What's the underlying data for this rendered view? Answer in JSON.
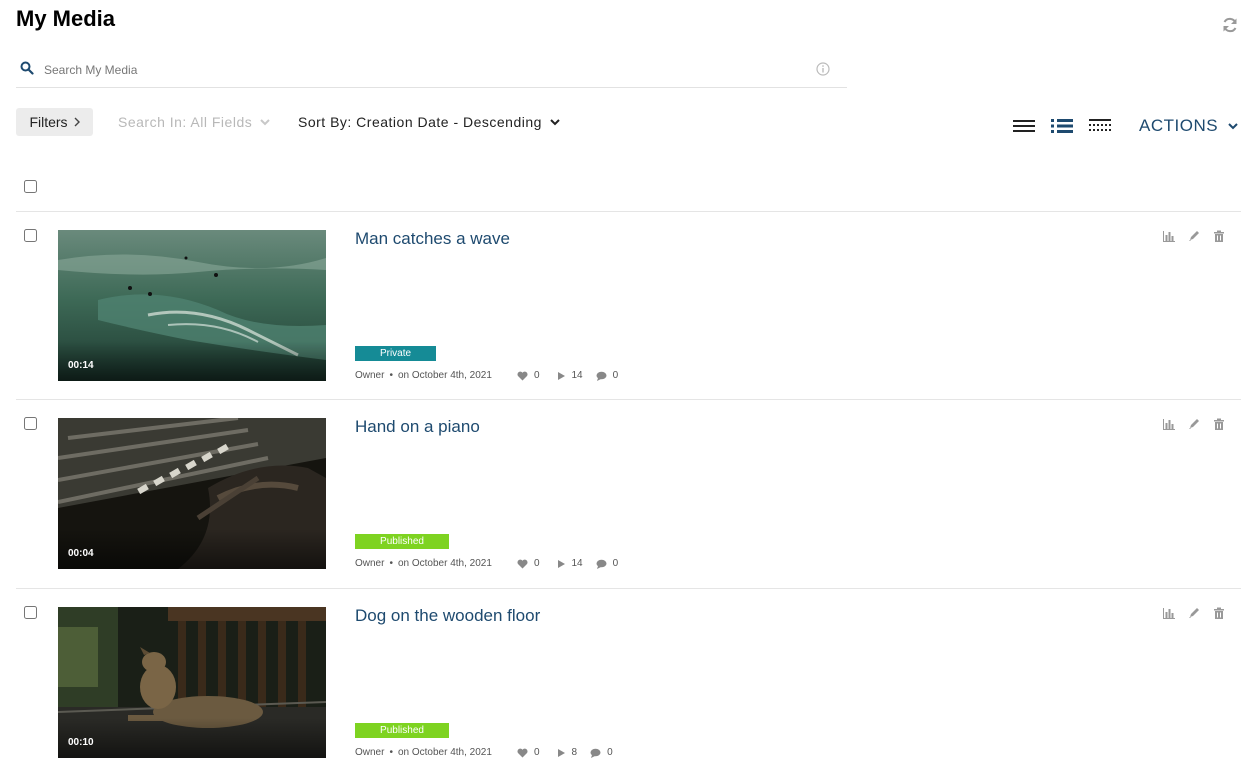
{
  "page": {
    "title": "My Media"
  },
  "search": {
    "placeholder": "Search My Media"
  },
  "toolbar": {
    "filters_label": "Filters",
    "search_in_label": "Search In: All Fields",
    "sort_by_label": "Sort By: Creation Date - Descending",
    "actions_label": "ACTIONS"
  },
  "icons": {
    "refresh": "refresh-icon",
    "search": "search-icon",
    "info": "info-icon",
    "view_list": "list-view-icon",
    "view_detailed": "detailed-view-icon",
    "view_table": "table-view-icon",
    "analytics": "bar-chart-icon",
    "edit": "pencil-icon",
    "delete": "trash-icon",
    "likes": "heart-icon",
    "plays": "play-icon",
    "comments": "comment-icon"
  },
  "colors": {
    "link": "#1e4a6f",
    "private_badge": "#158b96",
    "published_badge": "#7ed321",
    "icon_gray": "#999999"
  },
  "entries": [
    {
      "title": "Man catches a wave",
      "duration": "00:14",
      "status": "Private",
      "owner": "Owner",
      "date": "on October 4th, 2021",
      "likes": "0",
      "plays": "14",
      "comments": "0"
    },
    {
      "title": "Hand on a piano",
      "duration": "00:04",
      "status": "Published",
      "owner": "Owner",
      "date": "on October 4th, 2021",
      "likes": "0",
      "plays": "14",
      "comments": "0"
    },
    {
      "title": "Dog on the wooden floor",
      "duration": "00:10",
      "status": "Published",
      "owner": "Owner",
      "date": "on October 4th, 2021",
      "likes": "0",
      "plays": "8",
      "comments": "0"
    }
  ]
}
